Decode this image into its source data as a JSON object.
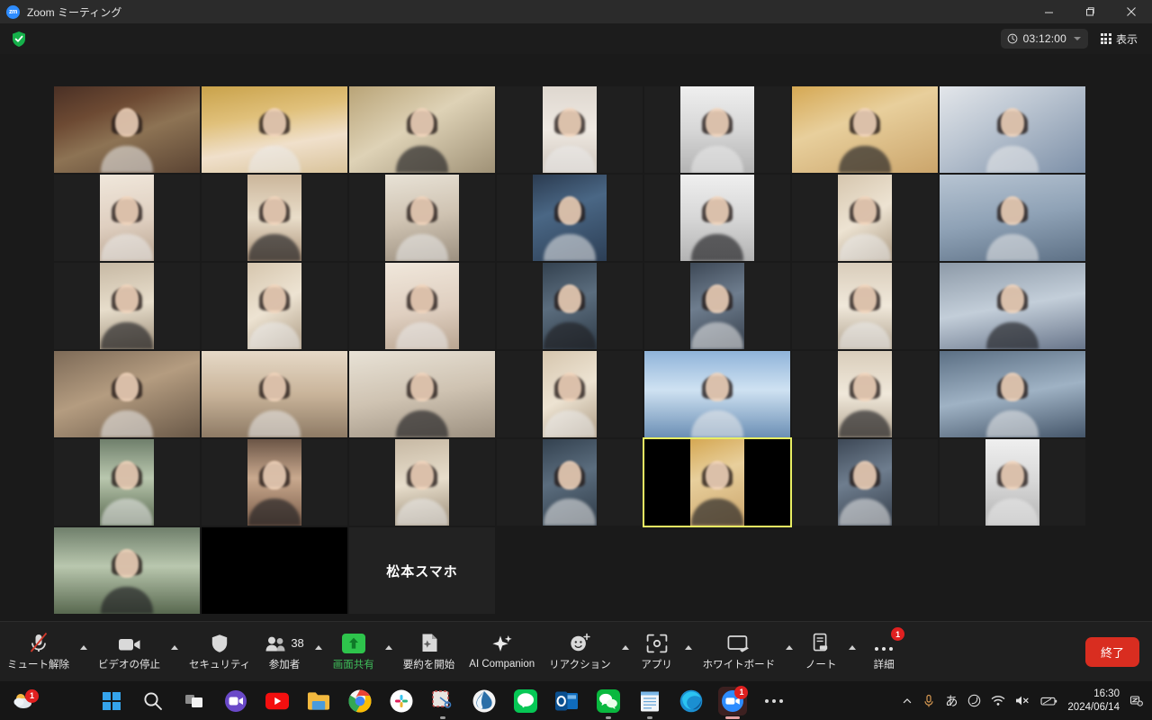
{
  "titlebar": {
    "app_icon": "zoom-logo-icon",
    "title": "Zoom ミーティング",
    "minimize": "minimize-icon",
    "maximize": "maximize-icon",
    "close": "close-icon"
  },
  "header": {
    "encryption_icon": "shield-check-icon",
    "timer_icon": "clock-icon",
    "timer": "03:12:00",
    "timer_caret": "chevron-down-icon",
    "view_icon": "grid-icon",
    "view_label": "表示"
  },
  "gallery": {
    "active_speaker_border": "#e8ee63",
    "tiles": [
      {
        "id": 1,
        "shape": "land",
        "style": "p1"
      },
      {
        "id": 2,
        "shape": "land",
        "style": "p2"
      },
      {
        "id": 3,
        "shape": "land",
        "style": "p3"
      },
      {
        "id": 4,
        "shape": "port",
        "style": "p5"
      },
      {
        "id": 5,
        "shape": "port-wide",
        "style": "p11"
      },
      {
        "id": 6,
        "shape": "land",
        "style": "p6"
      },
      {
        "id": 7,
        "shape": "land",
        "style": "p7"
      },
      {
        "id": 8,
        "shape": "port",
        "style": "p9"
      },
      {
        "id": 9,
        "shape": "port",
        "style": "p8"
      },
      {
        "id": 10,
        "shape": "port-wide",
        "style": "p12"
      },
      {
        "id": 11,
        "shape": "port-wide",
        "style": "p10"
      },
      {
        "id": 12,
        "shape": "port-wide",
        "style": "p11"
      },
      {
        "id": 13,
        "shape": "port",
        "style": "p19"
      },
      {
        "id": 14,
        "shape": "land",
        "style": "p15"
      },
      {
        "id": 15,
        "shape": "port",
        "style": "p21"
      },
      {
        "id": 16,
        "shape": "port",
        "style": "p19"
      },
      {
        "id": 17,
        "shape": "port-wide",
        "style": "p9"
      },
      {
        "id": 18,
        "shape": "port",
        "style": "p13"
      },
      {
        "id": 19,
        "shape": "port",
        "style": "p22"
      },
      {
        "id": 20,
        "shape": "port",
        "style": "p23"
      },
      {
        "id": 21,
        "shape": "land",
        "style": "p24"
      },
      {
        "id": 22,
        "shape": "land",
        "style": "p16"
      },
      {
        "id": 23,
        "shape": "land",
        "style": "p14"
      },
      {
        "id": 24,
        "shape": "land",
        "style": "p12"
      },
      {
        "id": 25,
        "shape": "port",
        "style": "p19"
      },
      {
        "id": 26,
        "shape": "land",
        "style": "p17"
      },
      {
        "id": 27,
        "shape": "port",
        "style": "p23"
      },
      {
        "id": 28,
        "shape": "land",
        "style": "p18"
      },
      {
        "id": 29,
        "shape": "port",
        "style": "p20"
      },
      {
        "id": 30,
        "shape": "port",
        "style": "p4"
      },
      {
        "id": 31,
        "shape": "port",
        "style": "p21"
      },
      {
        "id": 32,
        "shape": "port",
        "style": "p13"
      },
      {
        "id": 33,
        "shape": "port",
        "style": "p6",
        "active": true
      },
      {
        "id": 34,
        "shape": "port",
        "style": "p22"
      },
      {
        "id": 35,
        "shape": "port",
        "style": "p11"
      },
      {
        "id": 36,
        "shape": "land",
        "style": "p20"
      },
      {
        "id": 37,
        "shape": "black"
      },
      {
        "id": 38,
        "shape": "name",
        "name": "松本スマホ",
        "speaking": true
      }
    ]
  },
  "toolbar": {
    "items": [
      {
        "name": "mute-button",
        "icon": "microphone-muted-icon",
        "label": "ミュート解除",
        "caret": true
      },
      {
        "name": "video-button",
        "icon": "video-camera-icon",
        "label": "ビデオの停止",
        "caret": true
      },
      {
        "name": "security-button",
        "icon": "shield-icon",
        "label": "セキュリティ",
        "caret": false
      },
      {
        "name": "participants-button",
        "icon": "people-icon",
        "label": "参加者",
        "count": "38",
        "caret": true
      },
      {
        "name": "share-screen-button",
        "icon": "share-screen-icon",
        "label": "画面共有",
        "caret": true,
        "highlight": true
      },
      {
        "name": "summary-button",
        "icon": "summary-sparkle-icon",
        "label": "要約を開始",
        "caret": false
      },
      {
        "name": "ai-companion-button",
        "icon": "sparkles-icon",
        "label": "AI Companion",
        "caret": false
      },
      {
        "name": "reactions-button",
        "icon": "smiley-plus-icon",
        "label": "リアクション",
        "caret": true
      },
      {
        "name": "apps-button",
        "icon": "apps-icon",
        "label": "アプリ",
        "caret": true
      },
      {
        "name": "whiteboard-button",
        "icon": "whiteboard-icon",
        "label": "ホワイトボード",
        "caret": true
      },
      {
        "name": "notes-button",
        "icon": "notes-icon",
        "label": "ノート",
        "caret": true
      },
      {
        "name": "more-button",
        "icon": "ellipsis-icon",
        "label": "詳細",
        "badge": "1",
        "caret": false
      }
    ],
    "end_label": "終了",
    "end_color": "#d92d20"
  },
  "taskbar": {
    "weather_badge": "1",
    "apps": [
      {
        "name": "start-button",
        "icon": "windows-logo-icon"
      },
      {
        "name": "search-button",
        "icon": "search-icon"
      },
      {
        "name": "task-view-button",
        "icon": "task-view-icon"
      },
      {
        "name": "meet-app",
        "icon": "video-chat-icon"
      },
      {
        "name": "youtube-app",
        "icon": "youtube-icon"
      },
      {
        "name": "file-explorer-app",
        "icon": "folder-icon"
      },
      {
        "name": "chrome-app",
        "icon": "chrome-icon"
      },
      {
        "name": "slack-app",
        "icon": "slack-icon"
      },
      {
        "name": "snipping-tool-app",
        "icon": "scissors-icon",
        "running": true
      },
      {
        "name": "browser-app",
        "icon": "water-drop-icon"
      },
      {
        "name": "line-app",
        "icon": "line-icon"
      },
      {
        "name": "outlook-app",
        "icon": "outlook-icon"
      },
      {
        "name": "wechat-app",
        "icon": "wechat-icon",
        "running": true
      },
      {
        "name": "notepad-app",
        "icon": "notepad-icon",
        "running": true
      },
      {
        "name": "edge-app",
        "icon": "edge-icon"
      },
      {
        "name": "zoom-app",
        "icon": "zoom-icon",
        "badge": "1",
        "active": true
      },
      {
        "name": "overflow-button",
        "icon": "ellipsis-icon"
      }
    ],
    "tray": {
      "chevron": "chevron-up-icon",
      "mic": "microphone-icon",
      "ime": "あ",
      "moon": "moon-icon",
      "wifi": "wifi-icon",
      "volume": "speaker-muted-icon",
      "battery": "battery-icon",
      "time": "16:30",
      "date": "2024/06/14",
      "notification": "notification-icon"
    }
  }
}
